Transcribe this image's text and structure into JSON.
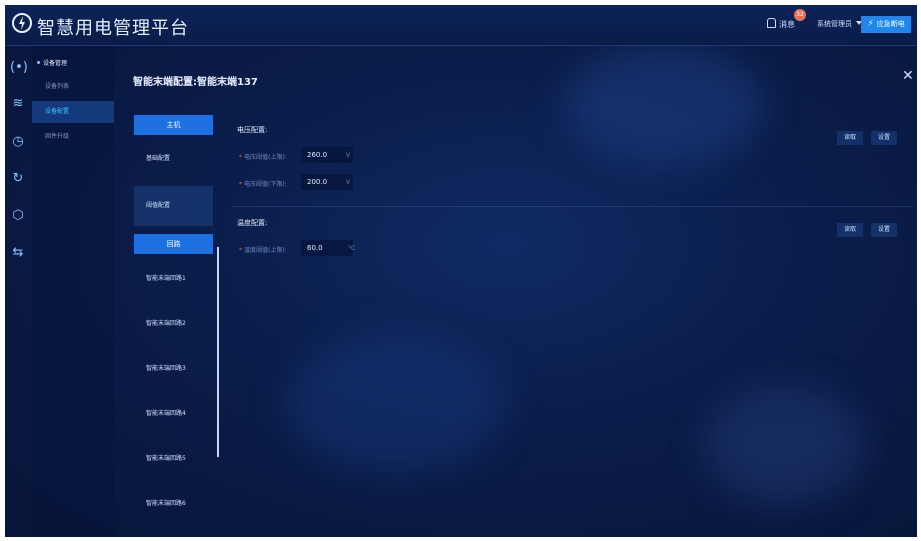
{
  "header": {
    "app_title": "智慧用电管理平台",
    "notify_label": "消息",
    "notify_count": "32",
    "user_label": "系统管理员",
    "action_label": "应急断电"
  },
  "rail": {
    "icons": [
      "signal-icon",
      "database-icon",
      "chart-icon",
      "refresh-icon",
      "cube-icon",
      "switch-icon"
    ]
  },
  "subnav": {
    "group_label": "设备管理",
    "items": [
      {
        "label": "设备列表"
      },
      {
        "label": "设备配置"
      },
      {
        "label": "固件升级"
      }
    ]
  },
  "dialog": {
    "title": "智能末端配置:智能末端137",
    "tabs": {
      "host": "主机",
      "loop": "回路"
    },
    "host_items": [
      "基础配置",
      "阈值配置"
    ],
    "loop_items": [
      "智能末端回路1",
      "智能末端回路2",
      "智能末端回路3",
      "智能末端回路4",
      "智能末端回路5",
      "智能末端回路6"
    ],
    "voltage": {
      "section": "电压配置:",
      "upper_label": "电压阈值(上限):",
      "upper_value": "260.0",
      "lower_label": "电压阈值(下限):",
      "lower_value": "200.0",
      "unit": "V",
      "read_label": "读取",
      "set_label": "设置"
    },
    "temperature": {
      "section": "温度配置:",
      "upper_label": "温度阈值(上限):",
      "upper_value": "60.0",
      "unit": "°C",
      "read_label": "读取",
      "set_label": "设置"
    }
  }
}
